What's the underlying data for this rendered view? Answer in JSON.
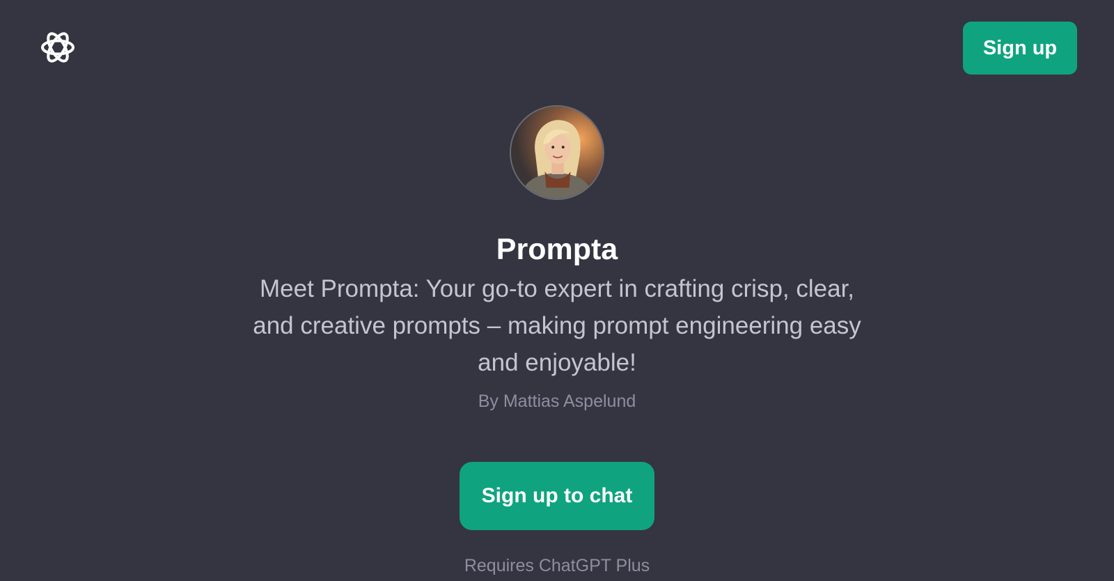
{
  "header": {
    "logo_icon": "openai-logo-icon",
    "signup_label": "Sign up"
  },
  "gpt": {
    "avatar_icon": "prompta-avatar",
    "name": "Prompta",
    "description": "Meet Prompta: Your go-to expert in crafting crisp, clear, and creative prompts – making prompt engineering easy and enjoyable!",
    "author": "By Mattias Aspelund"
  },
  "cta": {
    "label": "Sign up to chat",
    "note": "Requires ChatGPT Plus"
  },
  "colors": {
    "background": "#343541",
    "accent": "#10a37f",
    "title": "#ffffff",
    "description": "#c5c5d2",
    "muted": "#8e8ea0"
  }
}
